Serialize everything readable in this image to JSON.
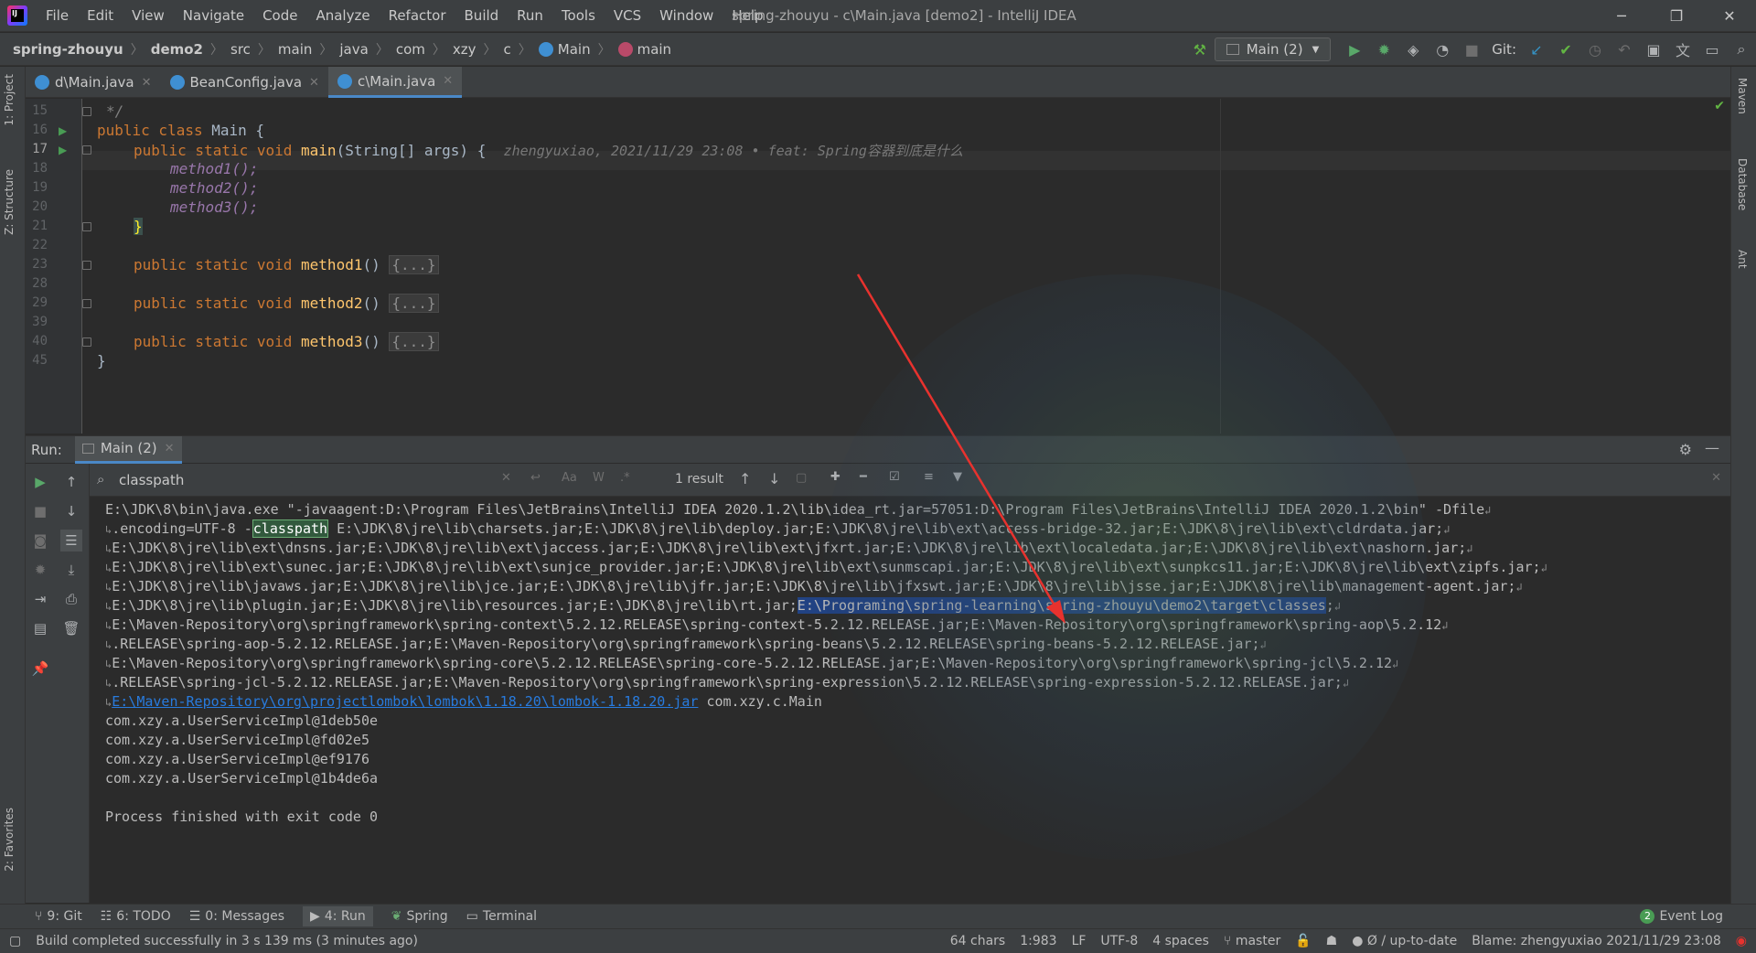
{
  "window": {
    "title": "spring-zhouyu - c\\Main.java [demo2] - IntelliJ IDEA",
    "menu": [
      "File",
      "Edit",
      "View",
      "Navigate",
      "Code",
      "Analyze",
      "Refactor",
      "Build",
      "Run",
      "Tools",
      "VCS",
      "Window",
      "Help"
    ],
    "minimize_glyph": "─",
    "restore_glyph": "❐",
    "close_glyph": "✕"
  },
  "breadcrumb": [
    "spring-zhouyu",
    "demo2",
    "src",
    "main",
    "java",
    "com",
    "xzy",
    "c",
    "Main",
    "main"
  ],
  "toolbar": {
    "run_config": "Main (2)",
    "git_label": "Git:"
  },
  "tabs": [
    {
      "label": "d\\Main.java"
    },
    {
      "label": "BeanConfig.java"
    },
    {
      "label": "c\\Main.java",
      "active": true
    }
  ],
  "left_strip": {
    "project": "1: Project",
    "structure": "Z: Structure",
    "favorites": "2: Favorites"
  },
  "right_strip": {
    "maven": "Maven",
    "database": "Database",
    "ant": "Ant"
  },
  "editor": {
    "line_numbers": [
      "15",
      "16",
      "17",
      "18",
      "19",
      "20",
      "21",
      "22",
      "23",
      "28",
      "29",
      "39",
      "40",
      "45"
    ],
    "lines": {
      "l15": "*/",
      "l16_kw": "public class",
      "l16_name": "Main {",
      "l17_kw": "public static void",
      "l17_fn": "main",
      "l17_rest": "(String[] args) {",
      "l17_blame": "zhengyuxiao, 2021/11/29 23:08 • feat: Spring容器到底是什么",
      "l18": "method1();",
      "l19": "method2();",
      "l20": "method3();",
      "l21": "}",
      "l23_kw": "public static void",
      "l23_fn": "method1",
      "l29_fn": "method2",
      "l40_fn": "method3",
      "collapsed": "{...}",
      "paren": "()",
      "l45": "}"
    }
  },
  "run_panel": {
    "label": "Run:",
    "tab": "Main (2)",
    "search_value": "classpath",
    "result_count": "1 result",
    "console": {
      "line1": "E:\\JDK\\8\\bin\\java.exe \"-javaagent:D:\\Program Files\\JetBrains\\IntelliJ IDEA 2020.1.2\\lib\\idea_rt.jar=57051:D:\\Program Files\\JetBrains\\IntelliJ IDEA 2020.1.2\\bin\" -Dfile",
      "line2_a": ".encoding=UTF-8 -",
      "line2_match": "classpath",
      "line2_b": " E:\\JDK\\8\\jre\\lib\\charsets.jar;E:\\JDK\\8\\jre\\lib\\deploy.jar;E:\\JDK\\8\\jre\\lib\\ext\\access-bridge-32.jar;E:\\JDK\\8\\jre\\lib\\ext\\cldrdata.jar;",
      "line3": "E:\\JDK\\8\\jre\\lib\\ext\\dnsns.jar;E:\\JDK\\8\\jre\\lib\\ext\\jaccess.jar;E:\\JDK\\8\\jre\\lib\\ext\\jfxrt.jar;E:\\JDK\\8\\jre\\lib\\ext\\localedata.jar;E:\\JDK\\8\\jre\\lib\\ext\\nashorn.jar;",
      "line4": "E:\\JDK\\8\\jre\\lib\\ext\\sunec.jar;E:\\JDK\\8\\jre\\lib\\ext\\sunjce_provider.jar;E:\\JDK\\8\\jre\\lib\\ext\\sunmscapi.jar;E:\\JDK\\8\\jre\\lib\\ext\\sunpkcs11.jar;E:\\JDK\\8\\jre\\lib\\ext\\zipfs.jar;",
      "line5": "E:\\JDK\\8\\jre\\lib\\javaws.jar;E:\\JDK\\8\\jre\\lib\\jce.jar;E:\\JDK\\8\\jre\\lib\\jfr.jar;E:\\JDK\\8\\jre\\lib\\jfxswt.jar;E:\\JDK\\8\\jre\\lib\\jsse.jar;E:\\JDK\\8\\jre\\lib\\management-agent.jar;",
      "line6_a": "E:\\JDK\\8\\jre\\lib\\plugin.jar;E:\\JDK\\8\\jre\\lib\\resources.jar;E:\\JDK\\8\\jre\\lib\\rt.jar;",
      "line6_sel": "E:\\Programing\\spring-learning\\spring-zhouyu\\demo2\\target\\classes",
      "line6_b": ";",
      "line7": "E:\\Maven-Repository\\org\\springframework\\spring-context\\5.2.12.RELEASE\\spring-context-5.2.12.RELEASE.jar;E:\\Maven-Repository\\org\\springframework\\spring-aop\\5.2.12",
      "line8": ".RELEASE\\spring-aop-5.2.12.RELEASE.jar;E:\\Maven-Repository\\org\\springframework\\spring-beans\\5.2.12.RELEASE\\spring-beans-5.2.12.RELEASE.jar;",
      "line9": "E:\\Maven-Repository\\org\\springframework\\spring-core\\5.2.12.RELEASE\\spring-core-5.2.12.RELEASE.jar;E:\\Maven-Repository\\org\\springframework\\spring-jcl\\5.2.12",
      "line10": ".RELEASE\\spring-jcl-5.2.12.RELEASE.jar;E:\\Maven-Repository\\org\\springframework\\spring-expression\\5.2.12.RELEASE\\spring-expression-5.2.12.RELEASE.jar;",
      "line11_link": "E:\\Maven-Repository\\org\\projectlombok\\lombok\\1.18.20\\lombok-1.18.20.jar",
      "line11_b": " com.xzy.c.Main",
      "out1": "com.xzy.a.UserServiceImpl@1deb50e",
      "out2": "com.xzy.a.UserServiceImpl@fd02e5",
      "out3": "com.xzy.a.UserServiceImpl@ef9176",
      "out4": "com.xzy.a.UserServiceImpl@1b4de6a",
      "exit": "Process finished with exit code 0"
    }
  },
  "bottom_tabs": [
    "9: Git",
    "6: TODO",
    "0: Messages",
    "4: Run",
    "Spring",
    "Terminal"
  ],
  "event_log": {
    "count": "2",
    "label": "Event Log"
  },
  "status": {
    "message": "Build completed successfully in 3 s 139 ms (3 minutes ago)",
    "chars": "64 chars",
    "position": "1:983",
    "line_sep": "LF",
    "encoding": "UTF-8",
    "indent": "4 spaces",
    "branch": "master",
    "vcs_state": "Ø / up-to-date",
    "blame": "Blame: zhengyuxiao 2021/11/29 23:08"
  },
  "colors": {
    "accent": "#4a88c7",
    "annotation_arrow": "#e8322e",
    "selection": "#214283",
    "find_match": "#32593d"
  }
}
